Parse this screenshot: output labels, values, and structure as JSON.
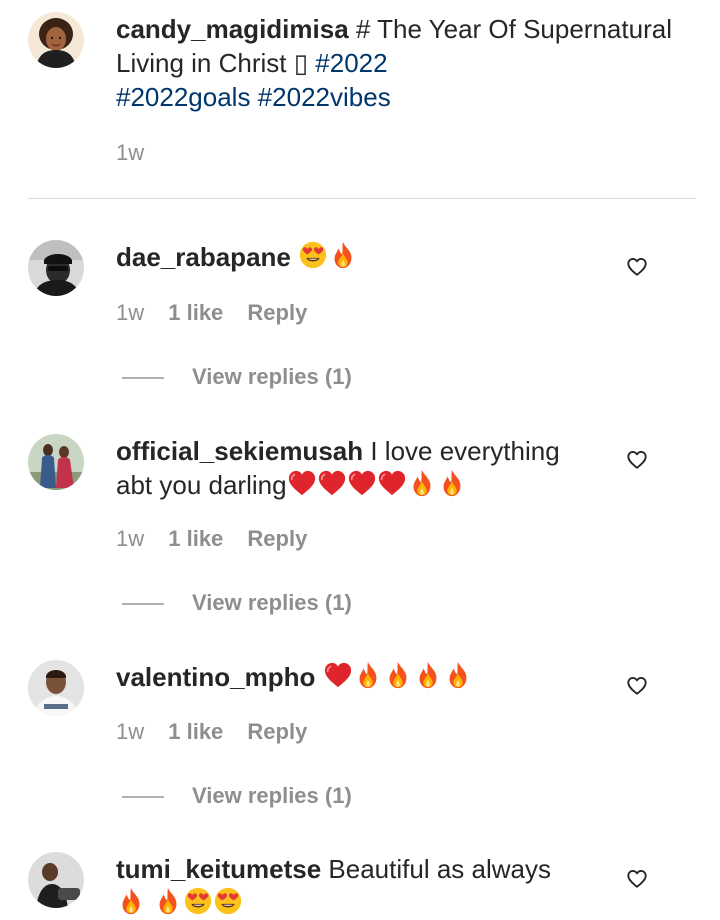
{
  "caption": {
    "username": "candy_magidimisa",
    "text": "# The Year Of Supernatural Living in Christ",
    "glyph": "▯",
    "tags": [
      "#2022",
      "#2022goals",
      "#2022vibes"
    ],
    "time": "1w"
  },
  "comments": [
    {
      "username": "dae_rabapane",
      "text": "",
      "emojis": [
        "smiling-face-with-heart-eyes",
        "fire"
      ],
      "time": "1w",
      "likes": "1 like",
      "reply_label": "Reply",
      "view_replies": "View replies (1)"
    },
    {
      "username": "official_sekiemusah",
      "text": "I love everything abt you darling",
      "emojis": [
        "red-heart",
        "red-heart",
        "red-heart",
        "red-heart",
        "fire",
        "fire"
      ],
      "time": "1w",
      "likes": "1 like",
      "reply_label": "Reply",
      "view_replies": "View replies (1)"
    },
    {
      "username": "valentino_mpho",
      "text": "",
      "emojis": [
        "red-heart",
        "fire",
        "fire",
        "fire",
        "fire"
      ],
      "time": "1w",
      "likes": "1 like",
      "reply_label": "Reply",
      "view_replies": "View replies (1)"
    },
    {
      "username": "tumi_keitumetse",
      "text": "Beautiful as always",
      "emojis": [
        "fire",
        "fire",
        "smiling-face-with-heart-eyes",
        "smiling-face-with-heart-eyes"
      ],
      "time": "",
      "likes": "",
      "reply_label": "",
      "view_replies": ""
    }
  ],
  "icons": {
    "like": "heart-outline-icon"
  },
  "colors": {
    "text": "#262626",
    "muted": "#8e8e8e",
    "hashtag": "#00376b",
    "divider": "#dbdbdb"
  }
}
